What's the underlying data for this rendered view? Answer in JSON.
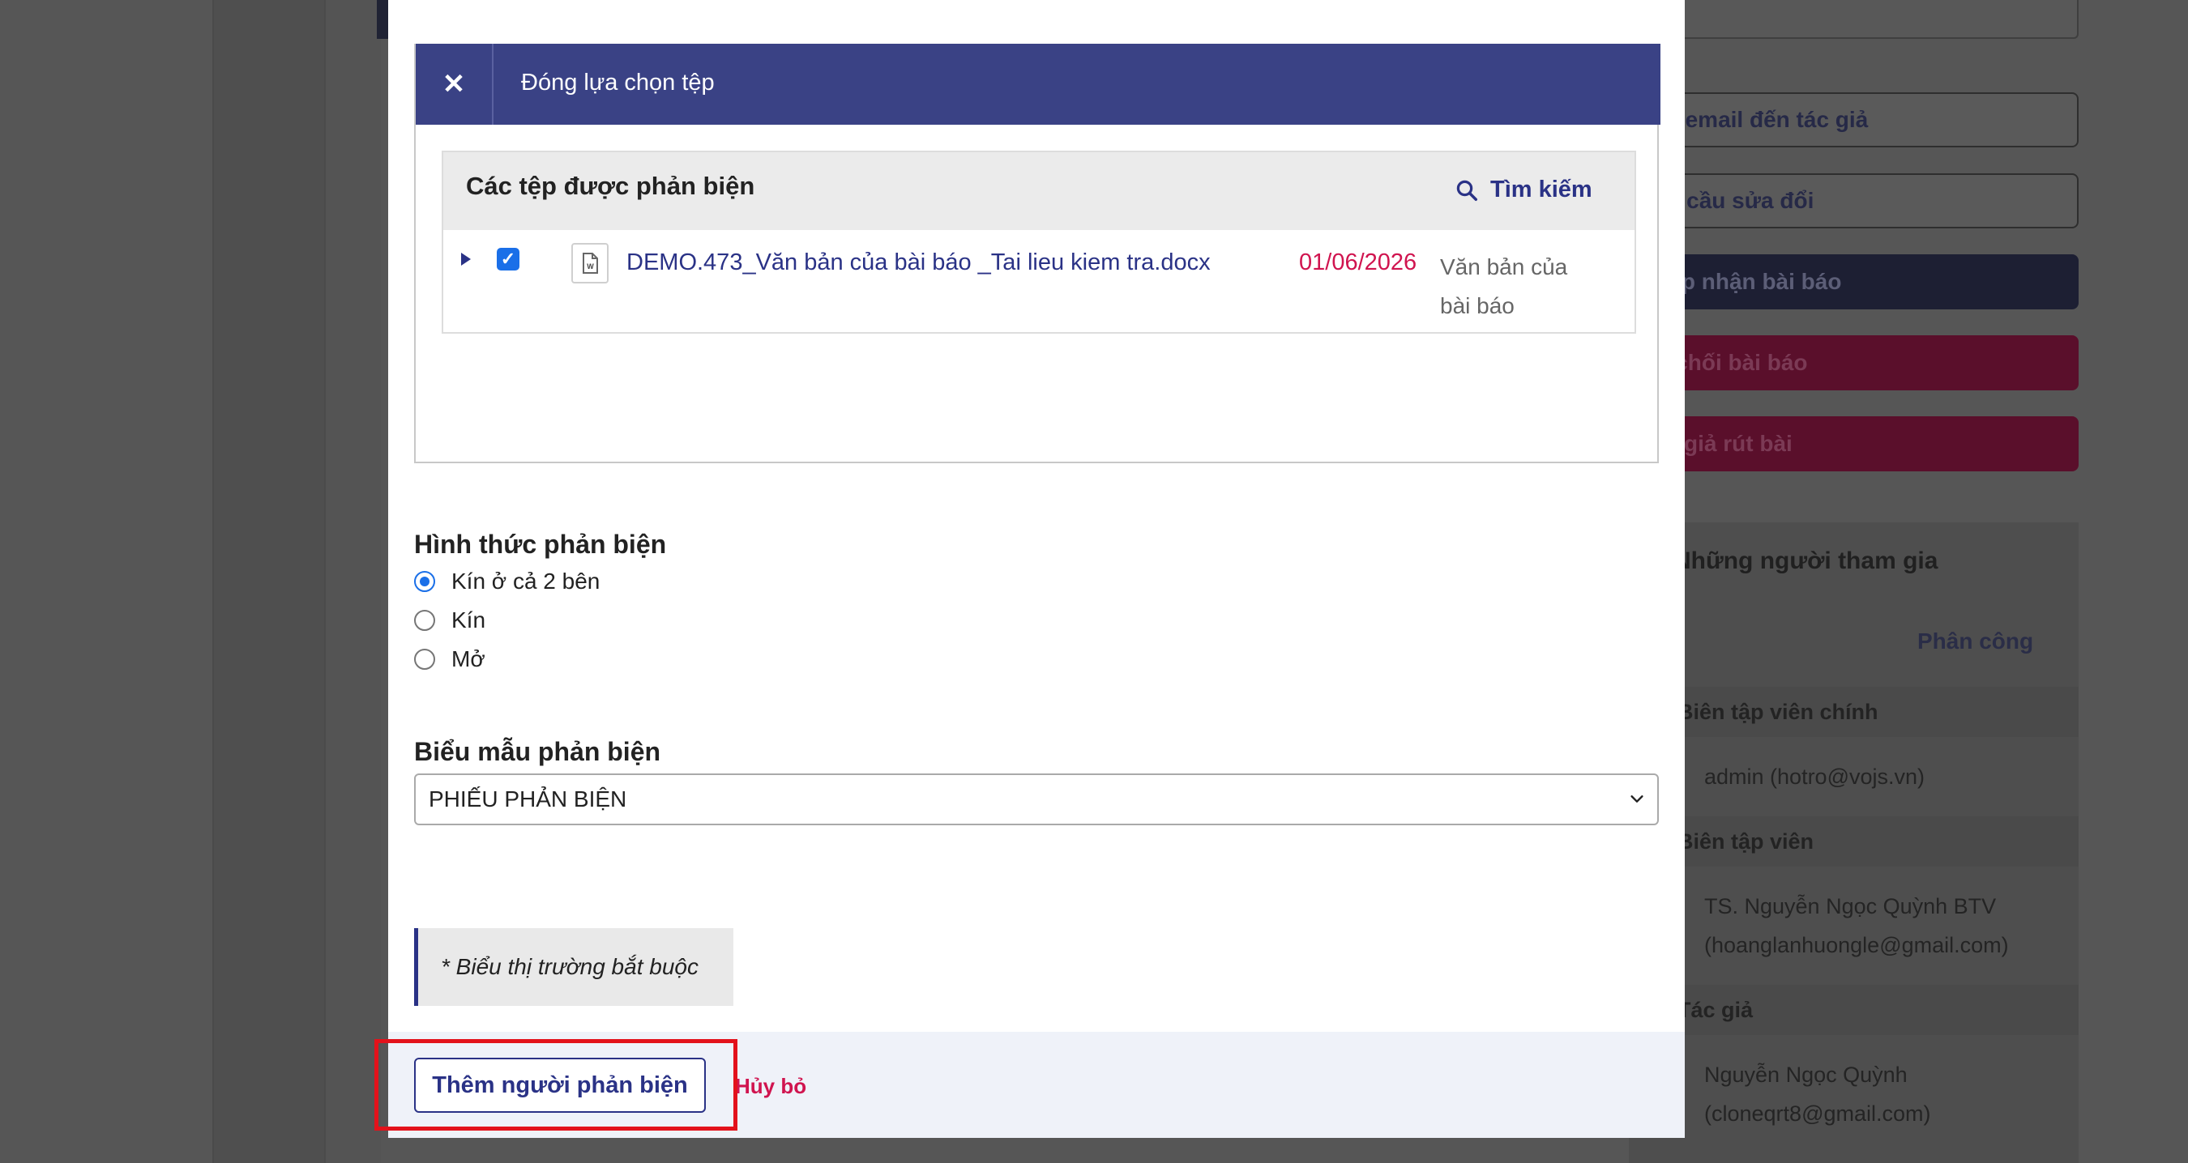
{
  "background": {
    "buttons": {
      "email_author": "Gửi email đến tác giả",
      "request_revisions": "Yêu cầu sửa đổi",
      "accept": "Chấp nhận bài báo",
      "decline": "Từ chối bài báo",
      "withdraw": "Tác giả rút bài"
    },
    "participants": {
      "title": "Những người tham gia",
      "assign_label": "Phân công",
      "roles": [
        {
          "role": "Biên tập viên chính",
          "people": [
            "admin (hotro@vojs.vn)"
          ]
        },
        {
          "role": "Biên tập viên",
          "people": [
            "TS. Nguyễn Ngọc Quỳnh BTV",
            "(hoanglanhuongle@gmail.com)"
          ]
        },
        {
          "role": "Tác giả",
          "people": [
            "Nguyễn Ngọc Quỳnh",
            "(cloneqrt8@gmail.com)"
          ]
        }
      ]
    }
  },
  "modal": {
    "file_picker": {
      "close_label": "Đóng lựa chọn tệp",
      "panel_title": "Các tệp được phản biện",
      "search_label": "Tìm kiếm",
      "files": [
        {
          "name": "DEMO.473_Văn bản của bài báo _Tai lieu kiem tra.docx",
          "date": "01/06/2026",
          "type": "Văn bản của bài báo",
          "checked": true
        }
      ]
    },
    "review_method": {
      "label": "Hình thức phản biện",
      "options": [
        "Kín ở cả 2 bên",
        "Kín",
        "Mở"
      ],
      "selected_index": 0
    },
    "review_form": {
      "label": "Biểu mẫu phản biện",
      "selected": "PHIẾU PHẢN BIỆN"
    },
    "required_note": "* Biểu thị trường bắt buộc",
    "footer": {
      "submit_label": "Thêm người phản biện",
      "cancel_label": "Hủy bỏ"
    }
  },
  "colors": {
    "primary": "#3a4285",
    "link": "#2a3286",
    "danger": "#d0144f",
    "highlight": "#e3121b"
  }
}
